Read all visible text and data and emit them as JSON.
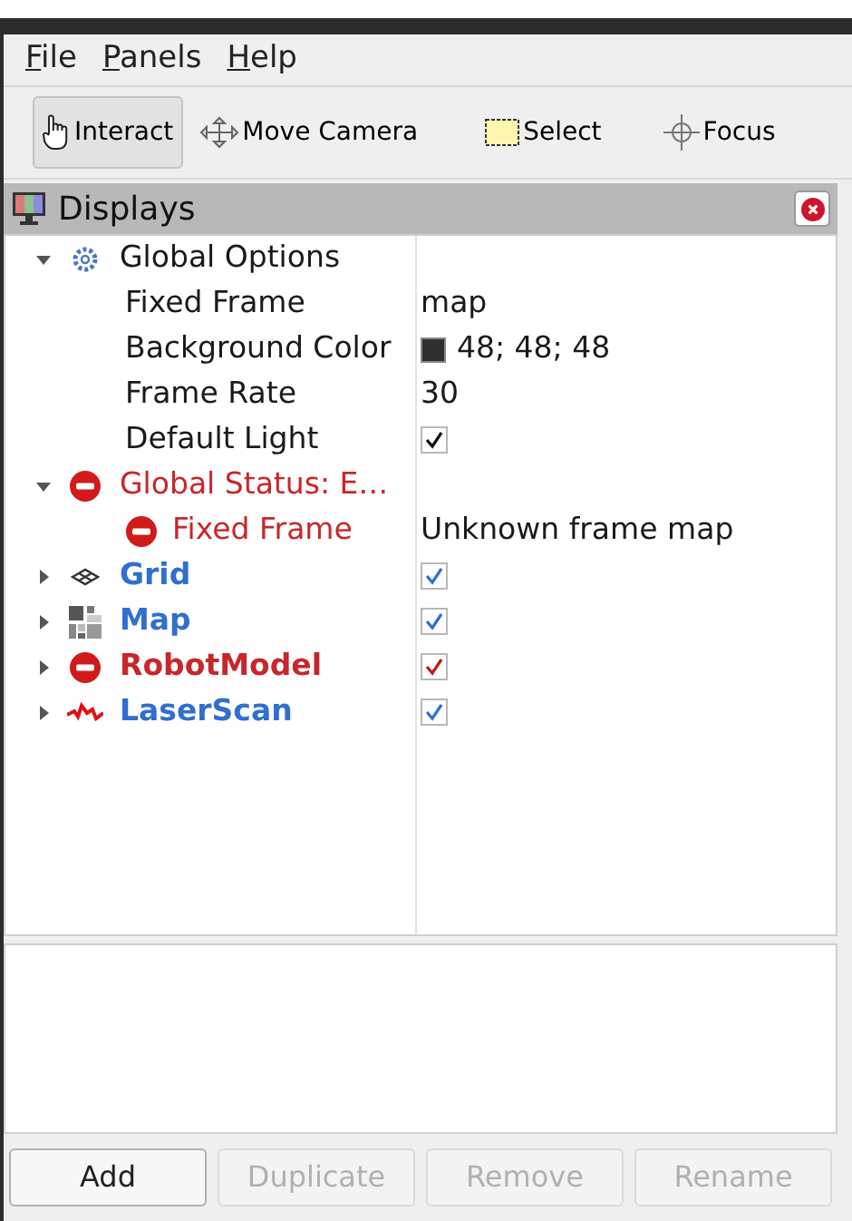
{
  "menu": [
    "File",
    "Panels",
    "Help"
  ],
  "toolbar": [
    {
      "label": "Interact",
      "kind": "interact",
      "selected": true
    },
    {
      "label": "Move Camera",
      "kind": "move",
      "selected": false
    },
    {
      "label": "Select",
      "kind": "select",
      "selected": false
    },
    {
      "label": "Focus",
      "kind": "focus",
      "selected": false
    }
  ],
  "panel": {
    "title": "Displays"
  },
  "tree": [
    {
      "kind": "options",
      "name": "Global Options",
      "error": false,
      "expanded": true,
      "children": [
        {
          "name": "Fixed Frame",
          "value": "map",
          "error": false
        },
        {
          "name": "Background Color",
          "value": "48; 48; 48",
          "color": "#303030",
          "error": false
        },
        {
          "name": "Frame Rate",
          "value": "30",
          "error": false
        },
        {
          "name": "Default Light",
          "checked": true,
          "error": false
        }
      ]
    },
    {
      "kind": "status",
      "name": "Global Status: E…",
      "error": true,
      "expanded": true,
      "children": [
        {
          "name": "Fixed Frame",
          "error": true,
          "value": "Unknown frame map"
        }
      ]
    },
    {
      "kind": "grid",
      "name": "Grid",
      "error": false,
      "expanded": false,
      "checked": true
    },
    {
      "kind": "map",
      "name": "Map",
      "error": false,
      "expanded": false,
      "checked": true
    },
    {
      "kind": "robot",
      "name": "RobotModel",
      "error": true,
      "expanded": false,
      "checked": true
    },
    {
      "kind": "laser",
      "name": "LaserScan",
      "error": false,
      "expanded": false,
      "checked": true
    }
  ],
  "buttons": [
    {
      "label": "Add",
      "disabled": false
    },
    {
      "label": "Duplicate",
      "disabled": true
    },
    {
      "label": "Remove",
      "disabled": true
    },
    {
      "label": "Rename",
      "disabled": true
    }
  ]
}
